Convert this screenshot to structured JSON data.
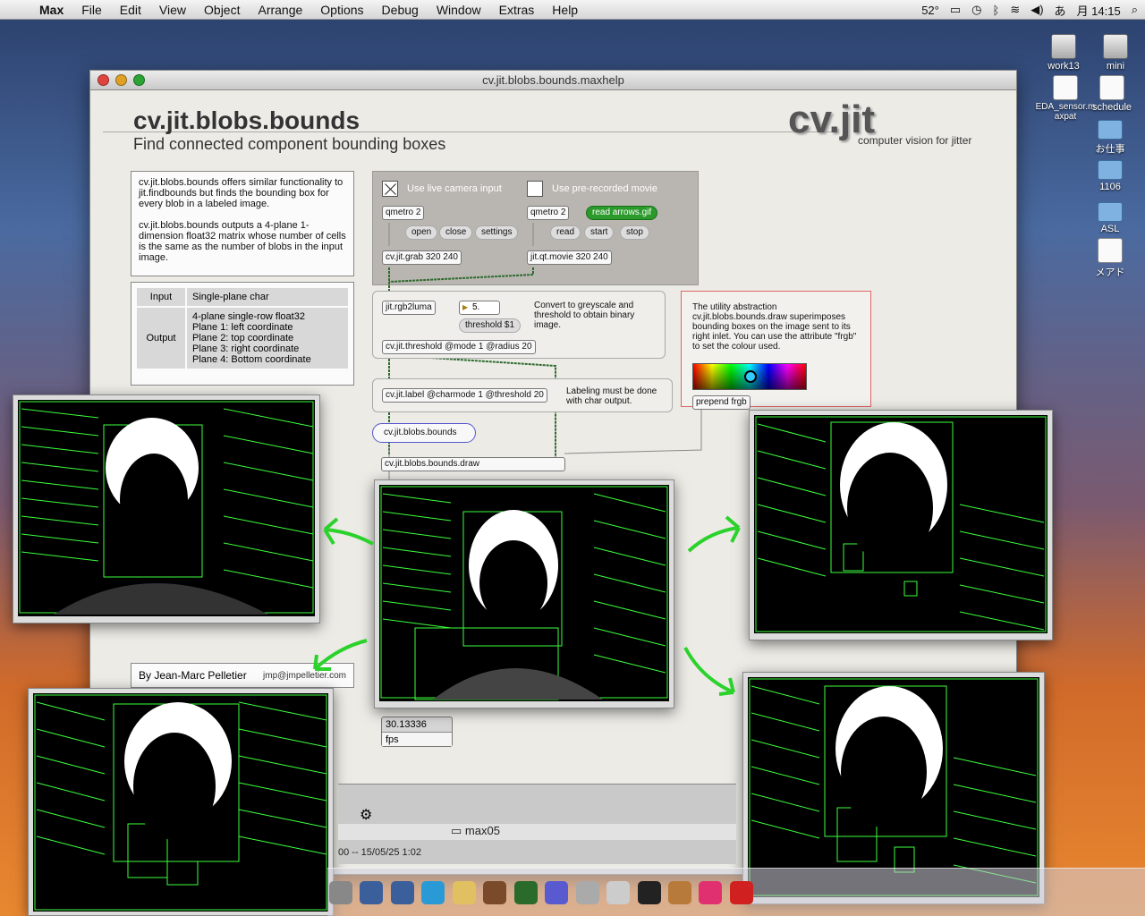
{
  "menubar": {
    "app": "Max",
    "items": [
      "File",
      "Edit",
      "View",
      "Object",
      "Arrange",
      "Options",
      "Debug",
      "Window",
      "Extras",
      "Help"
    ],
    "temp": "52°",
    "ime": "あ",
    "clock": "月 14:15"
  },
  "desktop": {
    "icons": [
      "work13",
      "mini",
      "EDA_sensor.maxpat",
      "schedule",
      "お仕事",
      "1106",
      "ASL",
      "メアド"
    ]
  },
  "window": {
    "title": "cv.jit.blobs.bounds.maxhelp",
    "header_title": "cv.jit.blobs.bounds",
    "header_subtitle": "Find connected component bounding boxes",
    "logo": "cv.jit",
    "logo_sub": "computer vision for jitter",
    "description": [
      "cv.jit.blobs.bounds offers similar functionality to jit.findbounds but finds the bounding box for every blob in a labeled image.",
      "cv.jit.blobs.bounds outputs a 4-plane 1-dimension float32 matrix whose number of cells is the same as the number of blobs in the input image."
    ],
    "io": {
      "input_key": "Input",
      "input_val": "Single-plane char",
      "output_key": "Output",
      "output_lines": [
        "4-plane single-row float32",
        "Plane 1: left coordinate",
        "Plane 2: top coordinate",
        "Plane 3: right coordinate",
        "Plane 4: Bottom coordinate"
      ]
    },
    "credit": {
      "author": "By Jean-Marc Pelletier",
      "email": "jmp@jmpelletier.com"
    },
    "patch": {
      "live_label": "Use live camera input",
      "movie_label": "Use pre-recorded movie",
      "qmetro_a": "qmetro 2",
      "qmetro_b": "qmetro 2",
      "read_arrows": "read arrows.gif",
      "open": "open",
      "close": "close",
      "settings": "settings",
      "read": "read",
      "start": "start",
      "stop": "stop",
      "grab": "cv.jit.grab 320 240",
      "movie": "jit.qt.movie 320 240",
      "rgb2luma": "jit.rgb2luma",
      "num": "5.",
      "threshold_msg": "threshold $1",
      "threshold_note": "Convert to greyscale and threshold to obtain binary image.",
      "threshold_obj": "cv.jit.threshold @mode 1 @radius 20",
      "label_obj": "cv.jit.label @charmode 1 @threshold 20",
      "label_note": "Labeling must be done with char output.",
      "bounds_obj": "cv.jit.blobs.bounds",
      "draw_obj": "cv.jit.blobs.bounds.draw",
      "utility_note": "The utility abstraction cv.jit.blobs.bounds.draw superimposes bounding boxes on the image sent to its right inlet. You can use the attribute \"frgb\" to set the colour used.",
      "prepend": "prepend frgb",
      "fps_value": "30.13336",
      "fps_label": "fps"
    }
  },
  "finder": {
    "folder": "max05",
    "status": "00  --  15/05/25 1:02"
  },
  "colors": {
    "accent_green": "#2bd22b",
    "bbox_green": "#3cff3c"
  }
}
